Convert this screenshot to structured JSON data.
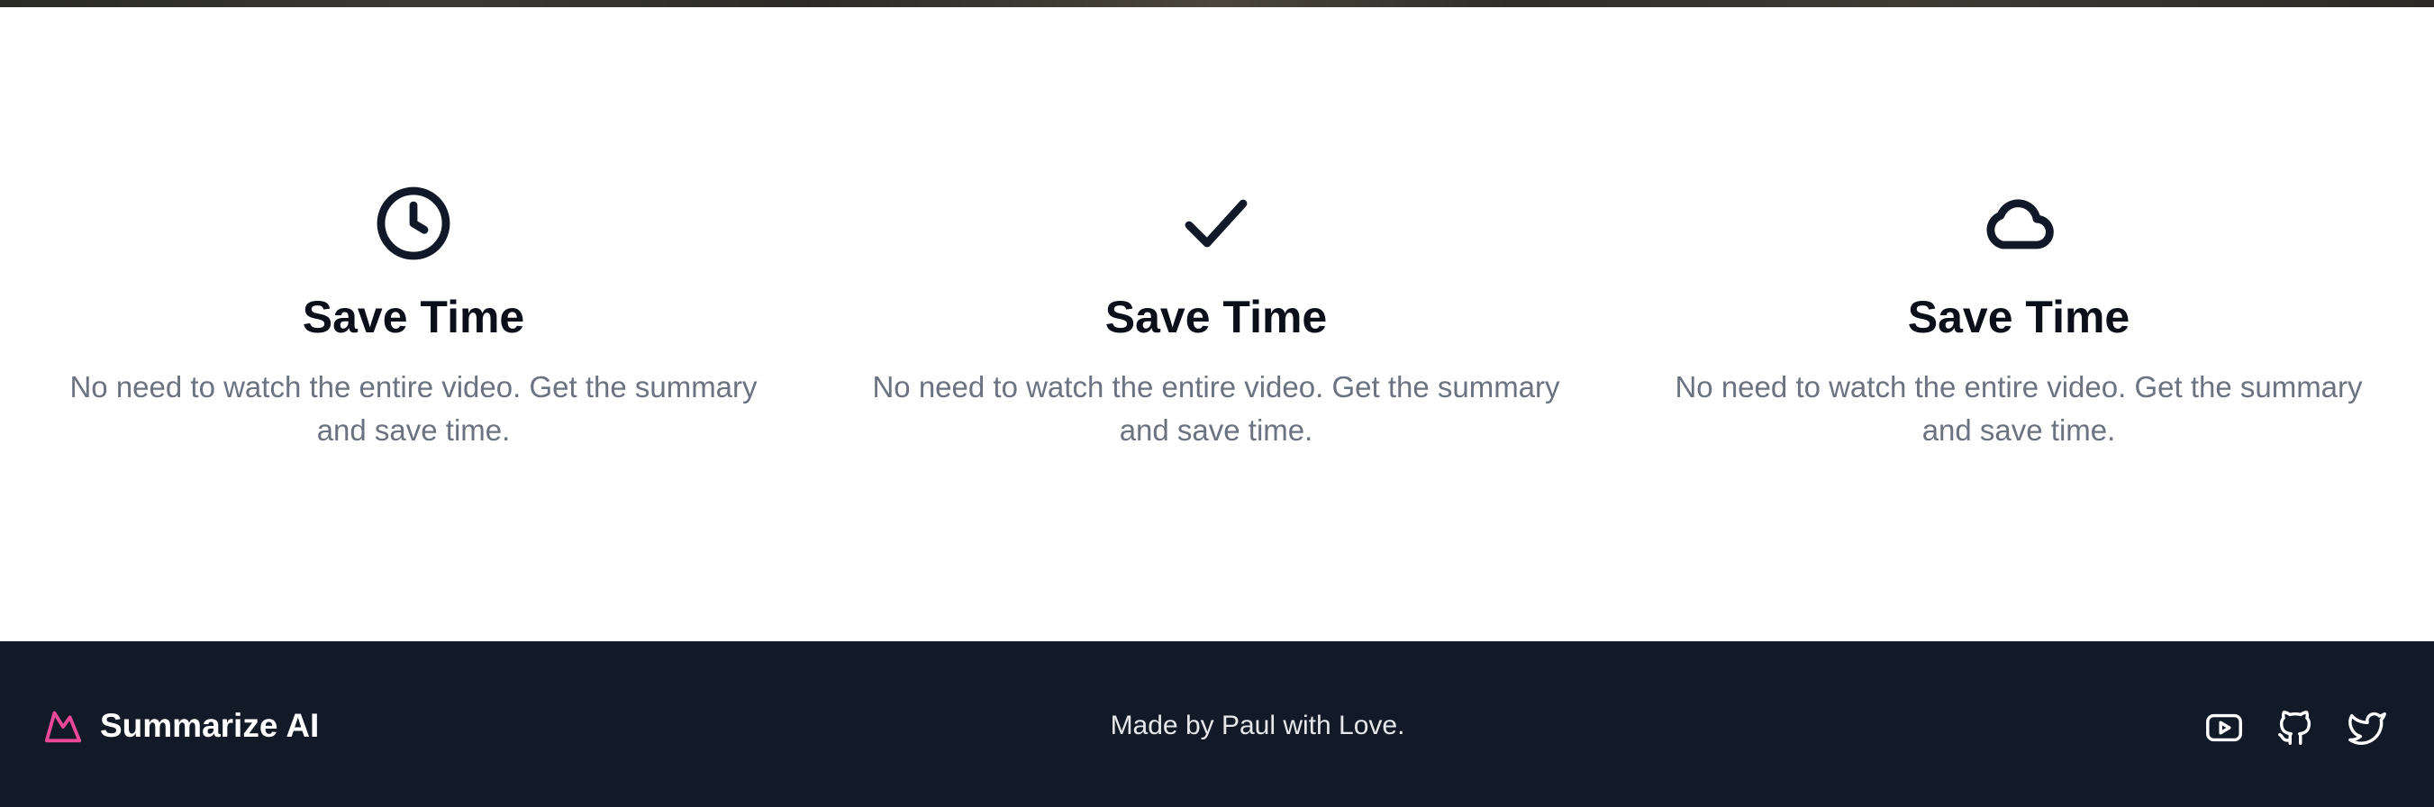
{
  "features": [
    {
      "icon": "clock-icon",
      "title": "Save Time",
      "description": "No need to watch the entire video. Get the summary and save time."
    },
    {
      "icon": "check-icon",
      "title": "Save Time",
      "description": "No need to watch the entire video. Get the summary and save time."
    },
    {
      "icon": "cloud-icon",
      "title": "Save Time",
      "description": "No need to watch the entire video. Get the summary and save time."
    }
  ],
  "footer": {
    "brand_name": "Summarize AI",
    "brand_icon": "crown-logo-icon",
    "credit": "Made by Paul with Love.",
    "social_icons": [
      "youtube-icon",
      "github-icon",
      "twitter-icon"
    ]
  },
  "colors": {
    "footer_bg": "#131a27",
    "brand_accent": "#ec4899",
    "title_text": "#0b0f1a",
    "body_text": "#6b7280"
  }
}
